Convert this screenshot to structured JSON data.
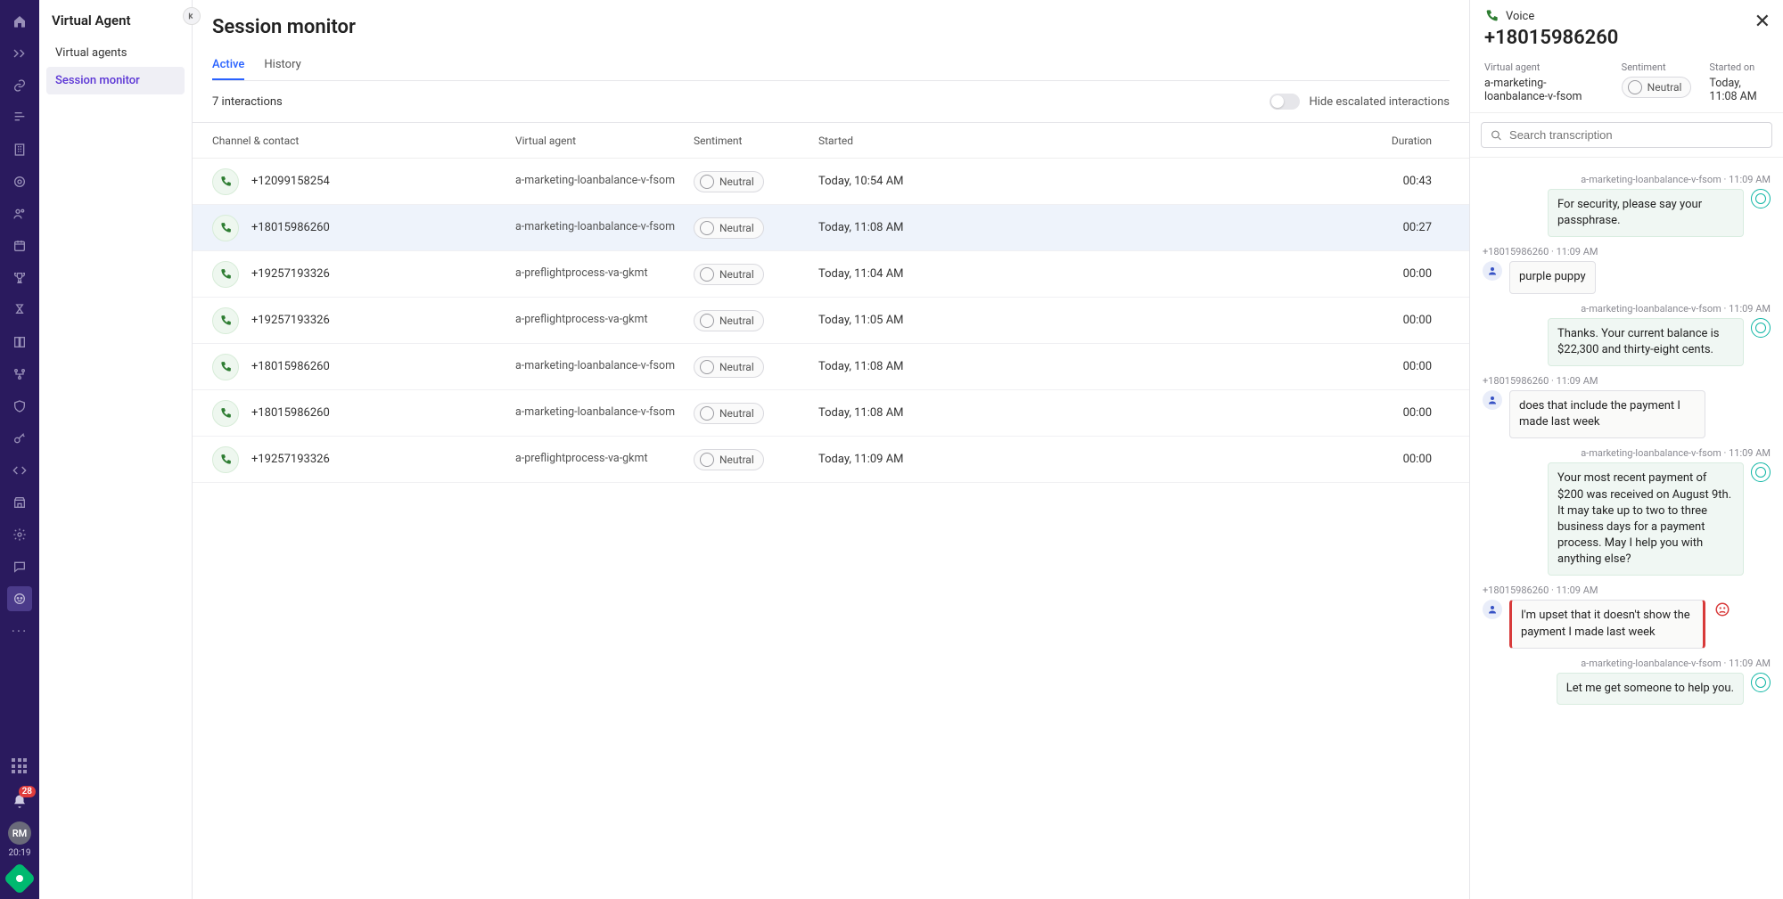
{
  "rail": {
    "notif_count": "28",
    "avatar_initials": "RM",
    "time": "20:19"
  },
  "sidebar": {
    "title": "Virtual Agent",
    "items": [
      {
        "label": "Virtual agents",
        "active": false
      },
      {
        "label": "Session monitor",
        "active": true
      }
    ]
  },
  "page": {
    "title": "Session monitor",
    "tabs": [
      {
        "label": "Active",
        "active": true
      },
      {
        "label": "History",
        "active": false
      }
    ],
    "interactions_count": "7 interactions",
    "hide_escalated_label": "Hide escalated interactions"
  },
  "columns": {
    "channel": "Channel & contact",
    "va": "Virtual agent",
    "sentiment": "Sentiment",
    "started": "Started",
    "duration": "Duration"
  },
  "rows": [
    {
      "contact": "+12099158254",
      "va": "a-marketing-loanbalance-v-fsom",
      "sentiment": "Neutral",
      "started": "Today, 10:54 AM",
      "duration": "00:43",
      "selected": false
    },
    {
      "contact": "+18015986260",
      "va": "a-marketing-loanbalance-v-fsom",
      "sentiment": "Neutral",
      "started": "Today, 11:08 AM",
      "duration": "00:27",
      "selected": true
    },
    {
      "contact": "+19257193326",
      "va": "a-preflightprocess-va-gkmt",
      "sentiment": "Neutral",
      "started": "Today, 11:04 AM",
      "duration": "00:00",
      "selected": false
    },
    {
      "contact": "+19257193326",
      "va": "a-preflightprocess-va-gkmt",
      "sentiment": "Neutral",
      "started": "Today, 11:05 AM",
      "duration": "00:00",
      "selected": false
    },
    {
      "contact": "+18015986260",
      "va": "a-marketing-loanbalance-v-fsom",
      "sentiment": "Neutral",
      "started": "Today, 11:08 AM",
      "duration": "00:00",
      "selected": false
    },
    {
      "contact": "+18015986260",
      "va": "a-marketing-loanbalance-v-fsom",
      "sentiment": "Neutral",
      "started": "Today, 11:08 AM",
      "duration": "00:00",
      "selected": false
    },
    {
      "contact": "+19257193326",
      "va": "a-preflightprocess-va-gkmt",
      "sentiment": "Neutral",
      "started": "Today, 11:09 AM",
      "duration": "00:00",
      "selected": false
    }
  ],
  "detail": {
    "channel_label": "Voice",
    "contact": "+18015986260",
    "meta": {
      "va_label": "Virtual agent",
      "va_value": "a-marketing-loanbalance-v-fsom",
      "sentiment_label": "Sentiment",
      "sentiment_value": "Neutral",
      "started_label": "Started on",
      "started_value": "Today, 11:08 AM"
    },
    "search_placeholder": "Search transcription"
  },
  "transcript": [
    {
      "side": "agent",
      "meta": "a-marketing-loanbalance-v-fsom · 11:09 AM",
      "text": "For security, please say your passphrase.",
      "sent": "neutral"
    },
    {
      "side": "user",
      "meta": "+18015986260 · 11:09 AM",
      "text": "purple puppy",
      "sent": ""
    },
    {
      "side": "agent",
      "meta": "a-marketing-loanbalance-v-fsom · 11:09 AM",
      "text": "Thanks. Your current balance is $22,300 and thirty-eight cents.",
      "sent": "neutral"
    },
    {
      "side": "user",
      "meta": "+18015986260 · 11:09 AM",
      "text": "does that include the payment I made last week",
      "sent": ""
    },
    {
      "side": "agent",
      "meta": "a-marketing-loanbalance-v-fsom · 11:09 AM",
      "text": "Your most recent payment of $200 was received on August 9th. It may take up to two to three business days for a payment process. May I help you with anything else?",
      "sent": "neutral"
    },
    {
      "side": "user",
      "meta": "+18015986260 · 11:09 AM",
      "text": "I'm upset that it doesn't show the payment I made last week",
      "sent": "negative"
    },
    {
      "side": "agent",
      "meta": "a-marketing-loanbalance-v-fsom · 11:09 AM",
      "text": "Let me get someone to help you.",
      "sent": "neutral"
    }
  ]
}
